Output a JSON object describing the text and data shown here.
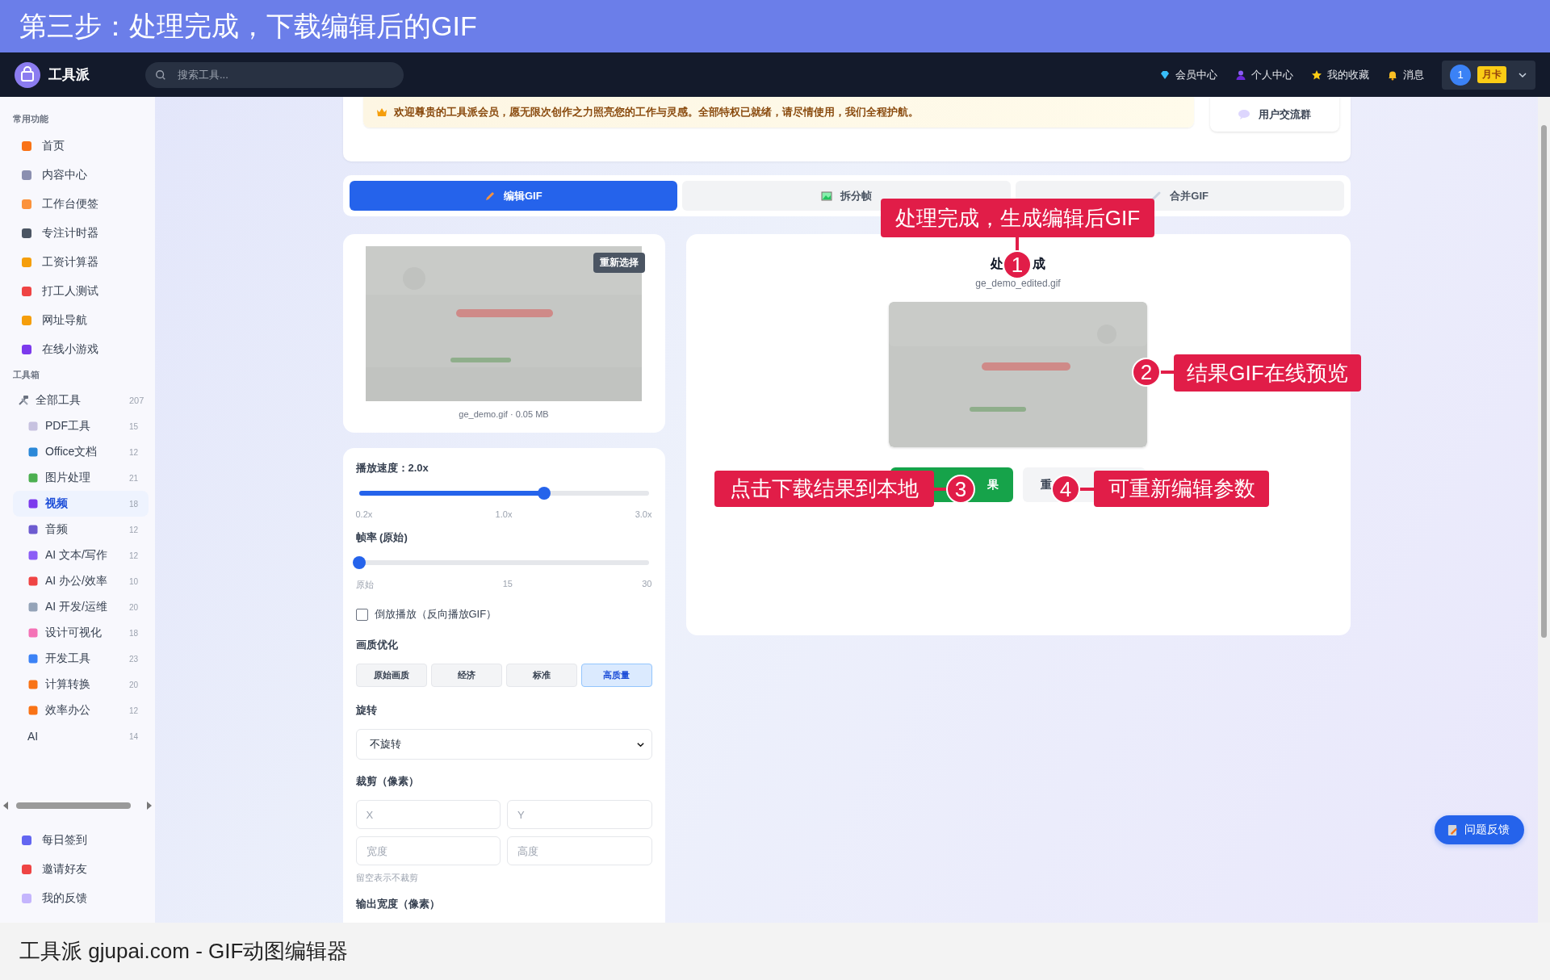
{
  "banner": {
    "title": "第三步：处理完成，下载编辑后的GIF"
  },
  "nav": {
    "logo": "工具派",
    "search": {
      "placeholder": "搜索工具..."
    },
    "links": [
      {
        "label": "会员中心"
      },
      {
        "label": "个人中心"
      },
      {
        "label": "我的收藏"
      },
      {
        "label": "消息"
      }
    ],
    "user": {
      "avatar": "1",
      "badge": "月卡"
    }
  },
  "sidebar": {
    "sections": [
      {
        "title": "常用功能",
        "items": [
          {
            "label": "首页",
            "selected": false
          },
          {
            "label": "内容中心",
            "selected": false
          },
          {
            "label": "工作台便签",
            "selected": false
          },
          {
            "label": "专注计时器",
            "selected": false
          },
          {
            "label": "工资计算器",
            "selected": false
          },
          {
            "label": "打工人测试",
            "selected": false
          },
          {
            "label": "网址导航",
            "selected": false
          },
          {
            "label": "在线小游戏",
            "selected": false
          }
        ]
      },
      {
        "title": "工具箱",
        "items": [
          {
            "label": "全部工具",
            "count": "207",
            "selected": false,
            "children": [
              {
                "label": "PDF工具",
                "count": "15",
                "kind": "icon",
                "selected": false
              },
              {
                "label": "Office文档",
                "count": "12",
                "kind": "icon",
                "selected": false
              },
              {
                "label": "图片处理",
                "count": "21",
                "kind": "icon",
                "selected": false
              },
              {
                "label": "视频",
                "count": "18",
                "kind": "icon",
                "selected": true
              },
              {
                "label": "音频",
                "count": "12",
                "kind": "icon",
                "selected": false
              },
              {
                "label": "AI 文本/写作",
                "count": "12",
                "kind": "icon",
                "selected": false
              },
              {
                "label": "AI 办公/效率",
                "count": "10",
                "kind": "icon",
                "selected": false
              },
              {
                "label": "AI 开发/运维",
                "count": "20",
                "kind": "icon",
                "selected": false
              },
              {
                "label": "设计可视化",
                "count": "18",
                "kind": "icon",
                "selected": false
              },
              {
                "label": "开发工具",
                "count": "23",
                "kind": "icon",
                "selected": false
              },
              {
                "label": "计算转换",
                "count": "20",
                "kind": "icon",
                "selected": false
              },
              {
                "label": "效率办公",
                "count": "12",
                "kind": "icon",
                "selected": false
              },
              {
                "label": "AI",
                "count": "14",
                "kind": "plain",
                "selected": false
              }
            ]
          }
        ]
      }
    ],
    "footer_items": [
      {
        "label": "每日签到",
        "selected": false
      },
      {
        "label": "邀请好友",
        "selected": false
      },
      {
        "label": "我的反馈",
        "selected": false
      }
    ]
  },
  "notice": {
    "text": "欢迎尊贵的工具派会员，愿无限次创作之力照亮您的工作与灵感。全部特权已就绪，请尽情使用，我们全程护航。"
  },
  "group_button": "用户交流群",
  "tabs": [
    {
      "label": "编辑GIF",
      "selected": true
    },
    {
      "label": "拆分帧",
      "selected": false
    },
    {
      "label": "合并GIF",
      "selected": false
    }
  ],
  "source": {
    "reselect": "重新选择",
    "caption": "ge_demo.gif · 0.05 MB"
  },
  "settings": {
    "speed": {
      "label": "播放速度：2.0x",
      "level": 0.64,
      "ticks": [
        "0.2x",
        "1.0x",
        "3.0x"
      ]
    },
    "fps": {
      "label": "帧率 (原始)",
      "level": 0,
      "ticks": [
        "原始",
        "15",
        "30"
      ]
    },
    "reverse": {
      "label": "倒放播放（反向播放GIF）",
      "checked": false
    },
    "quality": {
      "label": "画质优化",
      "options": [
        {
          "label": "原始画质",
          "selected": false
        },
        {
          "label": "经济",
          "selected": false
        },
        {
          "label": "标准",
          "selected": false
        },
        {
          "label": "高质量",
          "selected": true
        }
      ]
    },
    "rotation": {
      "label": "旋转",
      "value": "不旋转"
    },
    "crop": {
      "label": "裁剪（像素）",
      "fields": [
        {
          "placeholder": "X"
        },
        {
          "placeholder": "Y"
        },
        {
          "placeholder": "宽度"
        },
        {
          "placeholder": "高度"
        }
      ],
      "hint": "留空表示不裁剪"
    },
    "output_width": {
      "label": "输出宽度（像素）"
    }
  },
  "result": {
    "title_parts": [
      "处",
      "成"
    ],
    "filename": "ge_demo_edited.gif",
    "buttons": [
      {
        "label": "果",
        "kind": "primary"
      },
      {
        "label": "重",
        "kind": "secondary"
      }
    ]
  },
  "feedback_button": "问题反馈",
  "annotations": [
    {
      "number": "1",
      "text": "处理完成，生成编辑后GIF"
    },
    {
      "number": "2",
      "text": "结果GIF在线预览"
    },
    {
      "number": "3",
      "text": "点击下载结果到本地"
    },
    {
      "number": "4",
      "text": "可重新编辑参数"
    }
  ],
  "caption": "工具派 gjupai.com - GIF动图编辑器"
}
